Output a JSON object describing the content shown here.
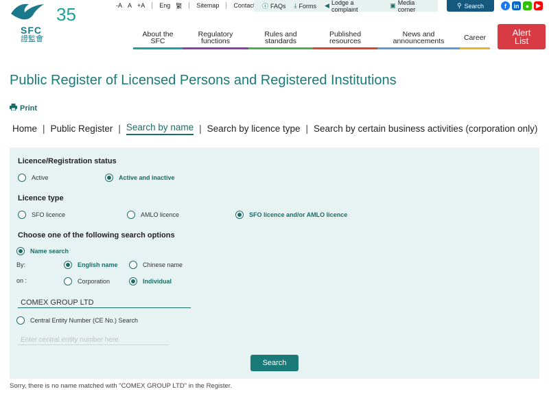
{
  "logo": {
    "abbr": "SFC",
    "chinese": "證監會",
    "anniversary": "35"
  },
  "top_util": {
    "font_decrease": "-A",
    "font_normal": "A",
    "font_increase": "+A",
    "lang_en": "Eng",
    "lang_zh": "繁",
    "sitemap": "Sitemap",
    "contact": "Contact us"
  },
  "util_links": [
    {
      "label": "FAQs",
      "icon": "help-icon"
    },
    {
      "label": "Forms",
      "icon": "download-icon"
    },
    {
      "label": "Lodge a complaint",
      "icon": "megaphone-icon"
    },
    {
      "label": "Media corner",
      "icon": "image-icon"
    }
  ],
  "search_label": "Search",
  "nav": [
    {
      "line1": "About the",
      "line2": "SFC",
      "color": "#1aa39a"
    },
    {
      "line1": "Regulatory",
      "line2": "functions",
      "color": "#8a3fa8"
    },
    {
      "line1": "Rules and",
      "line2": "standards",
      "color": "#4caf50"
    },
    {
      "line1": "Published",
      "line2": "resources",
      "color": "#d9452b"
    },
    {
      "line1": "News and",
      "line2": "announcements",
      "color": "#5b9bd5"
    },
    {
      "line1": "Career",
      "line2": "",
      "color": "#e8b423"
    }
  ],
  "alert": {
    "line1": "Alert",
    "line2": "List"
  },
  "page_title": "Public Register of Licensed Persons and Registered Institutions",
  "print_label": "Print",
  "breadcrumb": {
    "home": "Home",
    "public_register": "Public Register",
    "by_name": "Search by name",
    "by_licence": "Search by licence type",
    "by_activities": "Search by certain business activities (corporation only)"
  },
  "form": {
    "status_title": "Licence/Registration status",
    "status_active": "Active",
    "status_both": "Active and inactive",
    "type_title": "Licence type",
    "type_sfo": "SFO licence",
    "type_amlo": "AMLO licence",
    "type_both": "SFO licence and/or AMLO licence",
    "options_title": "Choose one of the following search options",
    "name_search": "Name search",
    "by_label": "By:",
    "on_label": "on :",
    "english_name": "English name",
    "chinese_name": "Chinese name",
    "corporation": "Corporation",
    "individual": "Individual",
    "name_value": "COMEX GROUP LTD",
    "ce_search": "Central Entity Number (CE No.) Search",
    "ce_placeholder": "Enter central entity number here",
    "submit": "Search"
  },
  "message": "Sorry, there is no name matched with \"COMEX GROUP LTD\" in the Register.",
  "colors": {
    "brand": "#1a7a78",
    "search_btn": "#15597f",
    "alert": "#d93b44",
    "panel": "#e6f3f2"
  }
}
